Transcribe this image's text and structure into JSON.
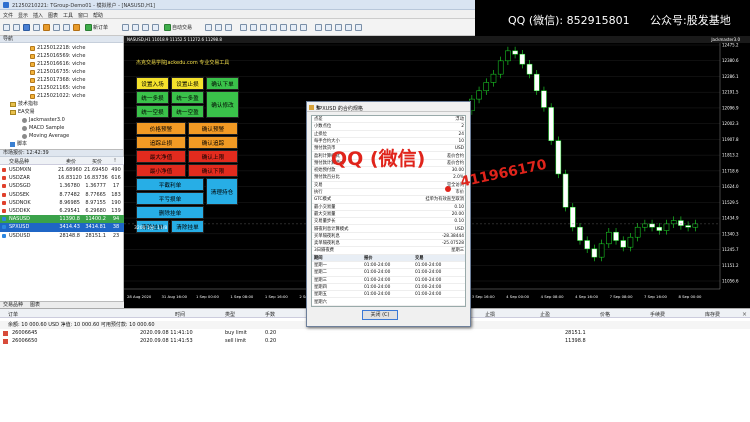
{
  "overlay": {
    "qq": "QQ (微信): 852915801",
    "gzh": "公众号:股发基地"
  },
  "window": {
    "title": "21250210221: TGroup-Demo01 - 模拟账户 - [NASUSD,H1]"
  },
  "menu": [
    "文件",
    "显示",
    "插入",
    "图表",
    "工具",
    "窗口",
    "帮助"
  ],
  "toolbar": {
    "new_order": "新订单",
    "auto_trading": "自动交易"
  },
  "navigator": {
    "title": "导航",
    "accounts": [
      "2125012218: viche",
      "2125016569: viche",
      "2125016616: viche",
      "2125016735: viche",
      "2125017368: viche",
      "2125021165: viche",
      "2125021022: viche"
    ],
    "tech_indicators": "技术指标",
    "ea_folder": "EA交易",
    "eas": [
      "Jackmaster3.0",
      "MACD Sample",
      "Moving Average"
    ],
    "scripts": "脚本",
    "tabs": [
      "常用",
      "收藏夹"
    ]
  },
  "market": {
    "title": "市场报价: 12:42:39",
    "headers": {
      "symbol": "交易品种",
      "bid": "卖价",
      "ask": "买价",
      "change": "!"
    },
    "rows": [
      {
        "sym": "USDMXN",
        "bid": "21.68960",
        "ask": "21.69450",
        "chg": "490",
        "dir": "down"
      },
      {
        "sym": "USDZAR",
        "bid": "16.83120",
        "ask": "16.83736",
        "chg": "616",
        "dir": "down"
      },
      {
        "sym": "USDSGD",
        "bid": "1.36780",
        "ask": "1.36777",
        "chg": "17",
        "dir": "down"
      },
      {
        "sym": "USDSEK",
        "bid": "8.77482",
        "ask": "8.77665",
        "chg": "183",
        "dir": "down"
      },
      {
        "sym": "USDNOK",
        "bid": "8.96985",
        "ask": "8.97155",
        "chg": "190",
        "dir": "down"
      },
      {
        "sym": "USDDKK",
        "bid": "6.29541",
        "ask": "6.29680",
        "chg": "139",
        "dir": "down"
      },
      {
        "sym": "NASUSD",
        "bid": "11390.8",
        "ask": "11400.2",
        "chg": "94",
        "dir": "up",
        "hl": "green"
      },
      {
        "sym": "SPXUSD",
        "bid": "3414.43",
        "ask": "3414.81",
        "chg": "38",
        "dir": "up",
        "hl": "blue"
      },
      {
        "sym": "USDUSD",
        "bid": "28148.8",
        "ask": "28151.1",
        "chg": "23",
        "dir": "up"
      }
    ],
    "tabs": [
      "交易品种",
      "图表"
    ]
  },
  "chart": {
    "title": "NASUSD,H1 11018.9 11152.5 11272.6 11298.8",
    "ea": "Jackmaster3.0",
    "x_labels": [
      "28 Aug 2020",
      "31 Aug 16:00",
      "1 Sep 00:00",
      "1 Sep 08:00",
      "1 Sep 16:00",
      "2 Sep 00:00",
      "2 Sep 08:00",
      "2 Sep 16:00",
      "3 Sep 00:00",
      "3 Sep 08:00",
      "3 Sep 16:00",
      "4 Sep 00:00",
      "4 Sep 08:00",
      "4 Sep 16:00",
      "7 Sep 08:00",
      "7 Sep 16:00",
      "8 Sep 00:00"
    ],
    "y_labels": [
      "12475.2",
      "12380.6",
      "12286.1",
      "12191.5",
      "12096.9",
      "12002.3",
      "11907.8",
      "11813.2",
      "11718.6",
      "11624.0",
      "11529.5",
      "11434.9",
      "11340.3",
      "11245.7",
      "11151.2",
      "11056.6"
    ]
  },
  "chart_data": {
    "type": "bar",
    "candles_close": [
      11580,
      11610,
      11650,
      11630,
      11700,
      11720,
      11690,
      11740,
      11780,
      11800,
      11820,
      11850,
      11900,
      11950,
      12000,
      12080,
      12150,
      12200,
      12250,
      12300,
      12380,
      12440,
      12420,
      12360,
      12300,
      12200,
      12100,
      11900,
      11700,
      11500,
      11380,
      11300,
      11250,
      11200,
      11280,
      11350,
      11300,
      11260,
      11320,
      11380,
      11400,
      11380,
      11360,
      11400,
      11420,
      11390,
      11380,
      11400
    ]
  },
  "ea_panel": {
    "banner": "杰克交易学院Jackedu.com 专业交易工具",
    "buttons": [
      {
        "label": "设置入场",
        "color": "yellow"
      },
      {
        "label": "设置止损",
        "color": "yellow"
      },
      {
        "label": "确认下单",
        "color": "green"
      },
      {
        "label": "统一多损",
        "color": "green"
      },
      {
        "label": "统一多盈",
        "color": "green"
      },
      {
        "label": "统一空损",
        "color": "green"
      },
      {
        "label": "统一空盈",
        "color": "green"
      },
      {
        "label": "确认修改",
        "color": "green"
      },
      {
        "label": "价格预警",
        "color": "orange"
      },
      {
        "label": "确认预警",
        "color": "orange"
      },
      {
        "label": "追踪止损",
        "color": "orange"
      },
      {
        "label": "确认追踪",
        "color": "orange"
      },
      {
        "label": "最大净值",
        "color": "red"
      },
      {
        "label": "确认上限",
        "color": "red"
      },
      {
        "label": "最小净值",
        "color": "red"
      },
      {
        "label": "确认下限",
        "color": "red"
      },
      {
        "label": "平截利单",
        "color": "cyan"
      },
      {
        "label": "平亏损单",
        "color": "cyan"
      },
      {
        "label": "清理持仓",
        "color": "cyan"
      },
      {
        "label": "删除挂单",
        "color": "cyan"
      },
      {
        "label": "清除挂单",
        "color": "cyan"
      },
      {
        "label": "清除挂单",
        "color": "cyan"
      }
    ],
    "footer": "3200  1分: 11/8"
  },
  "dialog": {
    "title": "SPXUSD 的合约规格",
    "help": "?",
    "close": "×",
    "props": [
      {
        "name": "点差",
        "value": "浮动"
      },
      {
        "name": "小数点位",
        "value": "2"
      },
      {
        "name": "止损位",
        "value": "24"
      },
      {
        "name": "每手合约大小",
        "value": "10"
      },
      {
        "name": "预付款货币",
        "value": "USD"
      },
      {
        "name": "盈利计算模式",
        "value": "差价合约"
      },
      {
        "name": "预付款计算模式",
        "value": "差价合约"
      },
      {
        "name": "初始预付款",
        "value": "30.00"
      },
      {
        "name": "预付款百分比",
        "value": "2.0%"
      },
      {
        "name": "交易",
        "value": "完全访问"
      },
      {
        "name": "执行",
        "value": "市价"
      },
      {
        "name": "GTC模式",
        "value": "挂单为有效直至取消"
      },
      {
        "name": "最小交易量",
        "value": "0.10"
      },
      {
        "name": "最大交易量",
        "value": "20.00"
      },
      {
        "name": "交易量步长",
        "value": "0.10"
      },
      {
        "name": "隔夜利息计算模式",
        "value": "USD"
      },
      {
        "name": "买单隔夜利息",
        "value": "-28.38444"
      },
      {
        "name": "卖单隔夜利息",
        "value": "-25.07528"
      },
      {
        "name": "3日隔夜费",
        "value": "星期三"
      }
    ],
    "session_headers": {
      "day": "期间",
      "quote": "报价",
      "trade": "交易"
    },
    "sessions": [
      {
        "day": "星期一",
        "quote": "01:00-24:00",
        "trade": "01:00-24:00"
      },
      {
        "day": "星期二",
        "quote": "01:00-24:00",
        "trade": "01:00-24:00"
      },
      {
        "day": "星期三",
        "quote": "01:00-24:00",
        "trade": "01:00-24:00"
      },
      {
        "day": "星期四",
        "quote": "01:00-24:00",
        "trade": "01:00-24:00"
      },
      {
        "day": "星期五",
        "quote": "01:00-24:00",
        "trade": "01:00-24:00"
      },
      {
        "day": "星期六",
        "quote": "",
        "trade": ""
      }
    ],
    "ok": "关闭 (C)"
  },
  "watermark": {
    "qq": "QQ (微信)",
    "number": "411966170"
  },
  "terminal": {
    "headers": [
      "订单",
      "时间",
      "类型",
      "手数",
      "止损",
      "止盈",
      "价格",
      "手续费",
      "库存费"
    ],
    "balance": "余额: 10 000.60 USD  净值: 10 000.60  可用预付款: 10 000.60",
    "orders": [
      {
        "id": "26006645",
        "time": "2020.09.08 11:41:10",
        "type": "buy limit",
        "lots": "0.20",
        "price": "28151.1"
      },
      {
        "id": "26006650",
        "time": "2020.09.08 11:41:53",
        "type": "sell limit",
        "lots": "0.20",
        "price": "11398.8"
      }
    ],
    "close": "×"
  }
}
